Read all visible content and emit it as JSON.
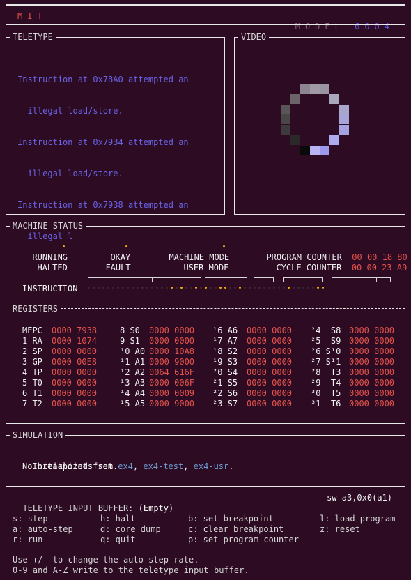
{
  "header": {
    "brand": "MIT",
    "model_label": "MODEL",
    "model_number": "6004",
    "brand_color": "#e5534b",
    "model_number_color": "#5b54e0"
  },
  "teletype": {
    "title": "TELETYPE",
    "lines": [
      "Instruction at 0x78A0 attempted an",
      "  illegal load/store.",
      "Instruction at 0x7934 attempted an",
      "  illegal load/store.",
      "Instruction at 0x7938 attempted an",
      "  illegal l"
    ],
    "text_color": "#6b63e8"
  },
  "video": {
    "title": "VIDEO"
  },
  "machine_status": {
    "title": "MACHINE STATUS",
    "flags": [
      {
        "label": "RUNNING",
        "on": true
      },
      {
        "label": "HALTED",
        "on": false
      },
      {
        "label": "OKAY",
        "on": true
      },
      {
        "label": "FAULT",
        "on": false
      },
      {
        "label": "MACHINE MODE",
        "on": true
      },
      {
        "label": "USER MODE",
        "on": false
      }
    ],
    "program_counter_label": "PROGRAM COUNTER",
    "program_counter": "00 00 18 80",
    "cycle_counter_label": "CYCLE COUNTER",
    "cycle_counter": "00 00 23 A9",
    "instruction_label": "INSTRUCTION",
    "instruction_bits": [
      0,
      0,
      0,
      0,
      0,
      0,
      0,
      0,
      0,
      0,
      0,
      0,
      0,
      0,
      0,
      0,
      0,
      1,
      0,
      1,
      0,
      0,
      1,
      0,
      1,
      0,
      0,
      1,
      1,
      0,
      0,
      1,
      0,
      0,
      0,
      0,
      0,
      0,
      0,
      0,
      0,
      1,
      0,
      0,
      0,
      0,
      0,
      1,
      1
    ]
  },
  "registers": {
    "title": "REGISTERS",
    "columns": [
      [
        {
          "name": "MEPC",
          "value": "0000 7938"
        },
        {
          "name": "1 RA",
          "value": "0000 1074"
        },
        {
          "name": "2 SP",
          "value": "0000 0000"
        },
        {
          "name": "3 GP",
          "value": "0000 00E8"
        },
        {
          "name": "4 TP",
          "value": "0000 0000"
        },
        {
          "name": "5 T0",
          "value": "0000 0000"
        },
        {
          "name": "6 T1",
          "value": "0000 0000"
        },
        {
          "name": "7 T2",
          "value": "0000 0000"
        }
      ],
      [
        {
          "name": "8 S0",
          "value": "0000 0000"
        },
        {
          "name": "9 S1",
          "value": "0000 0000"
        },
        {
          "name": "¹0 A0",
          "value": "0000 10A8"
        },
        {
          "name": "¹1 A1",
          "value": "0000 9000"
        },
        {
          "name": "¹2 A2",
          "value": "0064 616F"
        },
        {
          "name": "¹3 A3",
          "value": "0000 006F"
        },
        {
          "name": "¹4 A4",
          "value": "0000 0009"
        },
        {
          "name": "¹5 A5",
          "value": "0000 9000"
        }
      ],
      [
        {
          "name": "¹6 A6",
          "value": "0000 0000"
        },
        {
          "name": "¹7 A7",
          "value": "0000 0000"
        },
        {
          "name": "¹8 S2",
          "value": "0000 0000"
        },
        {
          "name": "¹9 S3",
          "value": "0000 0000"
        },
        {
          "name": "²0 S4",
          "value": "0000 0000"
        },
        {
          "name": "²1 S5",
          "value": "0000 0000"
        },
        {
          "name": "²2 S6",
          "value": "0000 0000"
        },
        {
          "name": "²3 S7",
          "value": "0000 0000"
        }
      ],
      [
        {
          "name": "²4  S8",
          "value": "0000 0000"
        },
        {
          "name": "²5  S9",
          "value": "0000 0000"
        },
        {
          "name": "²6 S¹0",
          "value": "0000 0000"
        },
        {
          "name": "²7 S¹1",
          "value": "0000 0000"
        },
        {
          "name": "²8  T3",
          "value": "0000 0000"
        },
        {
          "name": "²9  T4",
          "value": "0000 0000"
        },
        {
          "name": "³0  T5",
          "value": "0000 0000"
        },
        {
          "name": "³1  T6",
          "value": "0000 0000"
        }
      ]
    ]
  },
  "simulation": {
    "title": "SIMULATION",
    "init_prefix": "Initialized from",
    "sources": [
      "ex4",
      "ex4-test",
      "ex4-usr"
    ],
    "breakpoints": "No breakpoints set."
  },
  "input_buffer": {
    "label": "TELETYPE INPUT BUFFER:",
    "value": "(Empty)",
    "current_instruction": "sw a3,0x0(a1)"
  },
  "help": {
    "keys": [
      "s: step",
      "h: halt",
      "b: set breakpoint",
      "l: load program",
      "a: auto-step",
      "d: core dump",
      "c: clear breakpoint",
      "z: reset",
      "r: run",
      "q: quit",
      "p: set program counter",
      ""
    ],
    "footer": [
      "Use +/- to change the auto-step rate.",
      "0-9 and A-Z write to the teletype input buffer."
    ]
  }
}
